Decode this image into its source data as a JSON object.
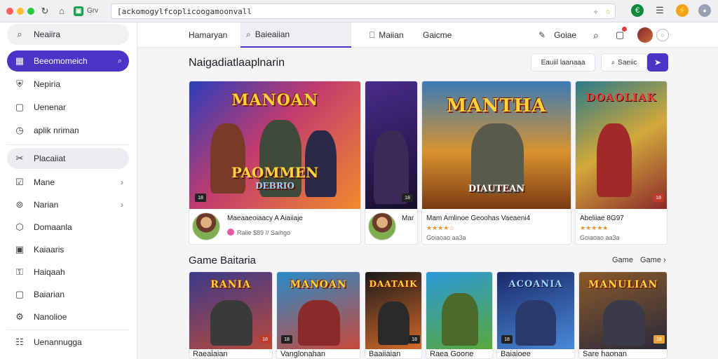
{
  "browser": {
    "ext_label": "Grv",
    "url": "[ackomogylfcoplicoogamoonvall",
    "ext_badge": "€"
  },
  "sidebar": {
    "search": "Neaiira",
    "items": [
      {
        "label": "Beeomomeich",
        "icon": "search-icon"
      },
      {
        "label": "Nepiria",
        "icon": "shield-icon"
      },
      {
        "label": "Uenenar",
        "icon": "square-icon"
      },
      {
        "label": "aplik nriman",
        "icon": "clock-icon"
      },
      {
        "label": "Placaiiat",
        "icon": "tag-icon"
      },
      {
        "label": "Mane",
        "icon": "check-square-icon"
      },
      {
        "label": "Narian",
        "icon": "coin-icon"
      },
      {
        "label": "Domaanla",
        "icon": "shield-outline-icon"
      },
      {
        "label": "Kaiaaris",
        "icon": "image-icon"
      },
      {
        "label": "Haiqaah",
        "icon": "key-icon"
      },
      {
        "label": "Baiarian",
        "icon": "square-icon"
      },
      {
        "label": "Nanolioe",
        "icon": "gear-icon"
      },
      {
        "label": "Uenannugga",
        "icon": "grid-icon"
      }
    ]
  },
  "topnav": {
    "home": "Hamaryan",
    "search": "Baieaiian",
    "library": "Maiian",
    "games": "Gaicme",
    "edit": "Goiae"
  },
  "featured": {
    "title": "Naigadiatlaaplnarin",
    "btn_ghost": "Eauiil laanaaa",
    "btn_search": "Saeiic",
    "cards": [
      {
        "art_title": "MANOAN",
        "art_sub": "PAOMMEN",
        "art_sub2": "DEBRIO",
        "badge": "18",
        "name": "Maeaaeoiaacy A Aiaiiaje",
        "meta": "Raiie $89 // Saihgo"
      },
      {
        "art_title": "",
        "art_sub": "",
        "art_sub2": "",
        "badge": "18",
        "name": "Mar",
        "meta": ""
      },
      {
        "art_title": "MANTHA",
        "art_sub": "DIAUTEAN",
        "art_sub2": "",
        "badge": "",
        "name": "Mam Amlinoe Geoohas Vaeaeni4",
        "meta": "Goiaoao aa3a"
      },
      {
        "art_title": "DOAOLIAK",
        "art_sub": "",
        "art_sub2": "",
        "badge": "18",
        "name": "Abeliiae 8G97",
        "meta": "Goiaoao aa3a"
      }
    ]
  },
  "row2": {
    "title": "Game Baitaria",
    "see_all_1": "Game",
    "see_all_2": "Game",
    "cards": [
      {
        "art_title": "RANIA",
        "label": "Raeaiaian",
        "badge": "18"
      },
      {
        "art_title": "MANOAN",
        "label": "Vanglonahan",
        "badge": "18"
      },
      {
        "art_title": "DAATAIK",
        "label": "Baaiiaian",
        "badge": "18"
      },
      {
        "art_title": "",
        "label": "Raea Goone",
        "badge": ""
      },
      {
        "art_title": "ACOANIA",
        "label": "Baiaioee",
        "badge": "18"
      },
      {
        "art_title": "MANULIAN",
        "label": "Sare haonan",
        "badge": "18"
      }
    ]
  }
}
